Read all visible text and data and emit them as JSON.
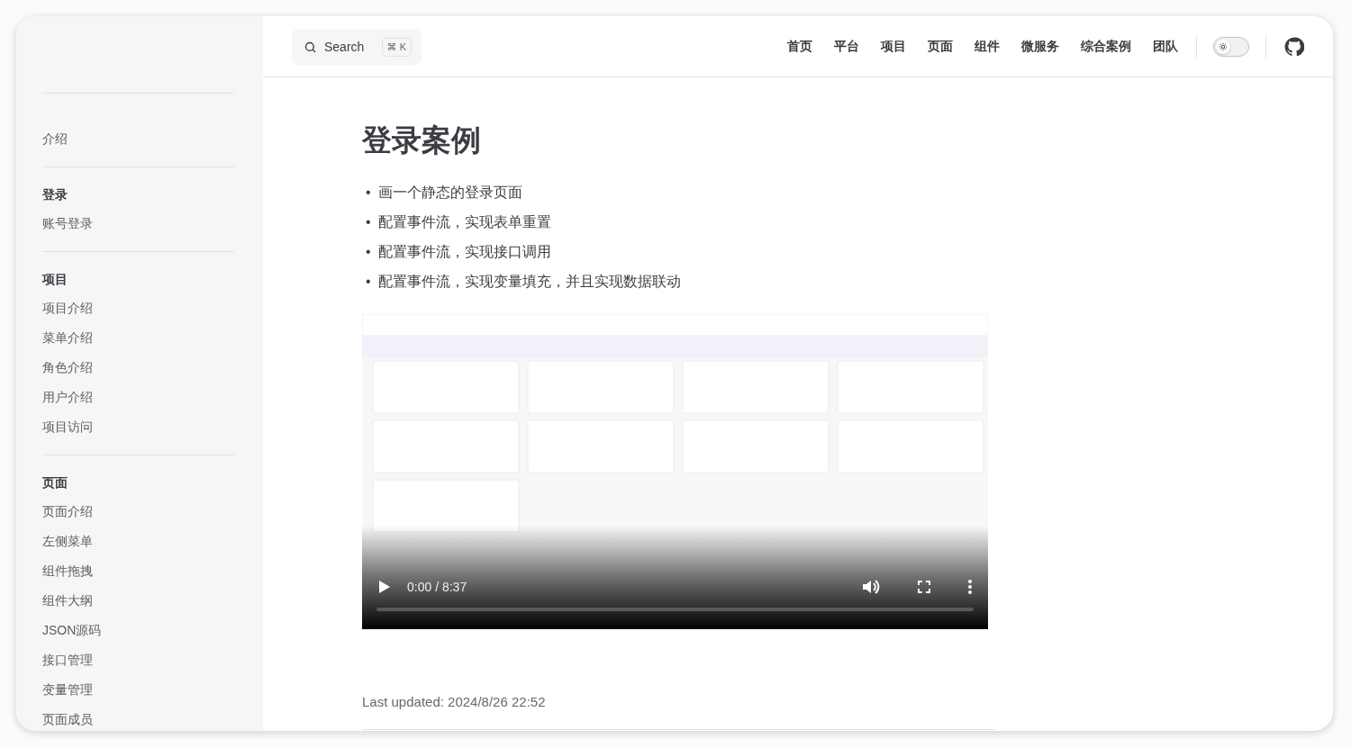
{
  "header": {
    "search": {
      "placeholder": "Search",
      "shortcut": "⌘ K"
    },
    "nav": [
      {
        "label": "首页"
      },
      {
        "label": "平台"
      },
      {
        "label": "项目"
      },
      {
        "label": "页面"
      },
      {
        "label": "组件"
      },
      {
        "label": "微服务"
      },
      {
        "label": "综合案例"
      },
      {
        "label": "团队"
      }
    ],
    "theme_switch": {
      "on": false
    }
  },
  "sidebar": {
    "groups": [
      {
        "items": [
          {
            "label": "介绍"
          }
        ]
      },
      {
        "title": "登录",
        "items": [
          {
            "label": "账号登录"
          }
        ]
      },
      {
        "title": "项目",
        "items": [
          {
            "label": "项目介绍"
          },
          {
            "label": "菜单介绍"
          },
          {
            "label": "角色介绍"
          },
          {
            "label": "用户介绍"
          },
          {
            "label": "项目访问"
          }
        ]
      },
      {
        "title": "页面",
        "items": [
          {
            "label": "页面介绍"
          },
          {
            "label": "左侧菜单"
          },
          {
            "label": "组件拖拽"
          },
          {
            "label": "组件大纲"
          },
          {
            "label": "JSON源码"
          },
          {
            "label": "接口管理"
          },
          {
            "label": "变量管理"
          },
          {
            "label": "页面成员"
          }
        ]
      }
    ]
  },
  "content": {
    "title": "登录案例",
    "bullets": [
      {
        "marker": "•",
        "text": "画一个静态的登录页面"
      },
      {
        "marker": "•",
        "text": "配置事件流，实现表单重置"
      },
      {
        "marker": "•",
        "text": "配置事件流，实现接口调用"
      },
      {
        "marker": "•",
        "text": "配置事件流，实现变量填充，并且实现数据联动"
      }
    ],
    "video": {
      "kind": "picture",
      "time": "0:00 / 8:37",
      "level": 0
    },
    "last_updated": "Last updated: 2024/8/26 22:52"
  }
}
